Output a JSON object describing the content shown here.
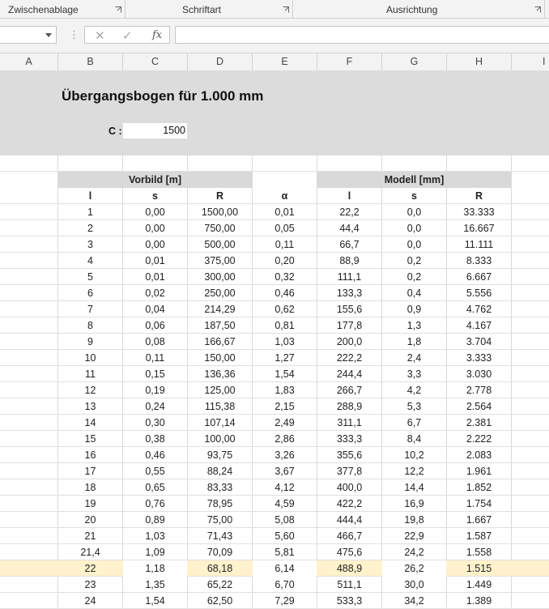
{
  "ribbon": {
    "groups": [
      {
        "label": "Zwischenablage"
      },
      {
        "label": "Schriftart"
      },
      {
        "label": "Ausrichtung"
      }
    ]
  },
  "formula_bar": {
    "name_box_value": "",
    "cancel_symbol": "✕",
    "enter_symbol": "✓",
    "fx_label": "fx",
    "content": ""
  },
  "columns": [
    "A",
    "B",
    "C",
    "D",
    "E",
    "F",
    "G",
    "H",
    "I"
  ],
  "sheet": {
    "title": "Übergangsbogen für 1.000 mm",
    "c_label": "C :",
    "c_value": "1500",
    "group_vorbild": "Vorbild [m]",
    "group_modell": "Modell [mm]",
    "headers": [
      "l",
      "s",
      "R",
      "α",
      "l",
      "s",
      "R"
    ],
    "rows": [
      [
        "1",
        "0,00",
        "1500,00",
        "0,01",
        "22,2",
        "0,0",
        "33.333"
      ],
      [
        "2",
        "0,00",
        "750,00",
        "0,05",
        "44,4",
        "0,0",
        "16.667"
      ],
      [
        "3",
        "0,00",
        "500,00",
        "0,11",
        "66,7",
        "0,0",
        "11.111"
      ],
      [
        "4",
        "0,01",
        "375,00",
        "0,20",
        "88,9",
        "0,2",
        "8.333"
      ],
      [
        "5",
        "0,01",
        "300,00",
        "0,32",
        "111,1",
        "0,2",
        "6.667"
      ],
      [
        "6",
        "0,02",
        "250,00",
        "0,46",
        "133,3",
        "0,4",
        "5.556"
      ],
      [
        "7",
        "0,04",
        "214,29",
        "0,62",
        "155,6",
        "0,9",
        "4.762"
      ],
      [
        "8",
        "0,06",
        "187,50",
        "0,81",
        "177,8",
        "1,3",
        "4.167"
      ],
      [
        "9",
        "0,08",
        "166,67",
        "1,03",
        "200,0",
        "1,8",
        "3.704"
      ],
      [
        "10",
        "0,11",
        "150,00",
        "1,27",
        "222,2",
        "2,4",
        "3.333"
      ],
      [
        "11",
        "0,15",
        "136,36",
        "1,54",
        "244,4",
        "3,3",
        "3.030"
      ],
      [
        "12",
        "0,19",
        "125,00",
        "1,83",
        "266,7",
        "4,2",
        "2.778"
      ],
      [
        "13",
        "0,24",
        "115,38",
        "2,15",
        "288,9",
        "5,3",
        "2.564"
      ],
      [
        "14",
        "0,30",
        "107,14",
        "2,49",
        "311,1",
        "6,7",
        "2.381"
      ],
      [
        "15",
        "0,38",
        "100,00",
        "2,86",
        "333,3",
        "8,4",
        "2.222"
      ],
      [
        "16",
        "0,46",
        "93,75",
        "3,26",
        "355,6",
        "10,2",
        "2.083"
      ],
      [
        "17",
        "0,55",
        "88,24",
        "3,67",
        "377,8",
        "12,2",
        "1.961"
      ],
      [
        "18",
        "0,65",
        "83,33",
        "4,12",
        "400,0",
        "14,4",
        "1.852"
      ],
      [
        "19",
        "0,76",
        "78,95",
        "4,59",
        "422,2",
        "16,9",
        "1.754"
      ],
      [
        "20",
        "0,89",
        "75,00",
        "5,08",
        "444,4",
        "19,8",
        "1.667"
      ],
      [
        "21",
        "1,03",
        "71,43",
        "5,60",
        "466,7",
        "22,9",
        "1.587"
      ],
      [
        "21,4",
        "1,09",
        "70,09",
        "5,81",
        "475,6",
        "24,2",
        "1.558"
      ],
      [
        "22",
        "1,18",
        "68,18",
        "6,14",
        "488,9",
        "26,2",
        "1.515"
      ],
      [
        "23",
        "1,35",
        "65,22",
        "6,70",
        "511,1",
        "30,0",
        "1.449"
      ],
      [
        "24",
        "1,54",
        "62,50",
        "7,29",
        "533,3",
        "34,2",
        "1.389"
      ]
    ],
    "highlighted_row_index": 22,
    "highlight_color": "#fff2cc",
    "band_color": "#dcdcdc",
    "header_band_color": "#d9d9d9"
  }
}
